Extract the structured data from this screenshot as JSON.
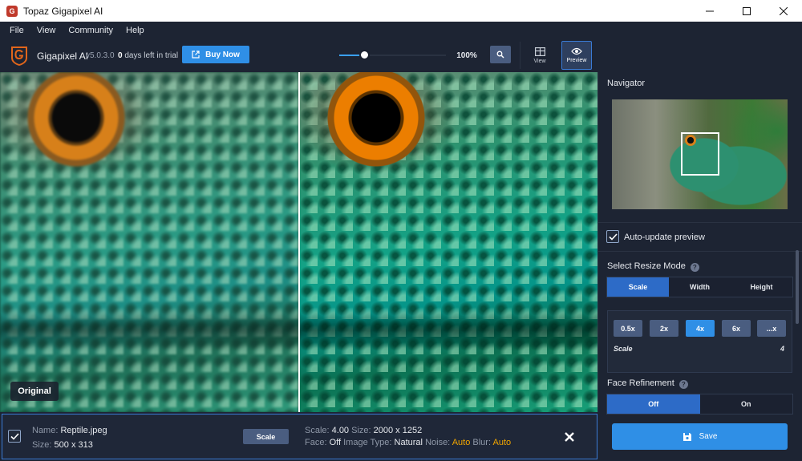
{
  "window": {
    "title": "Topaz Gigapixel AI",
    "app_icon": "G"
  },
  "menu": [
    "File",
    "View",
    "Community",
    "Help"
  ],
  "toolbar": {
    "brand": "Gigapixel AI",
    "version": "v5.0.3.0",
    "trial_days": "0",
    "trial_text": "days left in trial",
    "buy_label": "Buy Now",
    "zoom": "100%",
    "view_label": "View",
    "preview_label": "Preview"
  },
  "image": {
    "original_tag": "Original"
  },
  "navigator": {
    "title": "Navigator"
  },
  "settings": {
    "auto_update_label": "Auto-update preview",
    "auto_update_checked": true,
    "resize_mode_title": "Select Resize Mode",
    "resize_modes": [
      "Scale",
      "Width",
      "Height"
    ],
    "resize_mode_selected": "Scale",
    "scale_options": [
      "0.5x",
      "2x",
      "4x",
      "6x",
      "...x"
    ],
    "scale_selected": "4x",
    "scale_label": "Scale",
    "scale_value": "4",
    "face_title": "Face Refinement",
    "face_options": [
      "Off",
      "On"
    ],
    "face_selected": "Off",
    "save_label": "Save"
  },
  "info": {
    "name_label": "Name:",
    "name": "Reptile.jpeg",
    "size_label": "Size:",
    "size": "500 x 313",
    "scale_chip": "Scale",
    "scale_label": "Scale:",
    "scale": "4.00",
    "out_size_label": "Size:",
    "out_size": "2000 x 1252",
    "face_label": "Face:",
    "face": "Off",
    "type_label": "Image Type:",
    "type": "Natural",
    "noise_label": "Noise:",
    "noise": "Auto",
    "blur_label": "Blur:",
    "blur": "Auto"
  },
  "colors": {
    "accent": "#2f8fe6",
    "panel": "#1d2433",
    "warning": "#f0a500"
  }
}
